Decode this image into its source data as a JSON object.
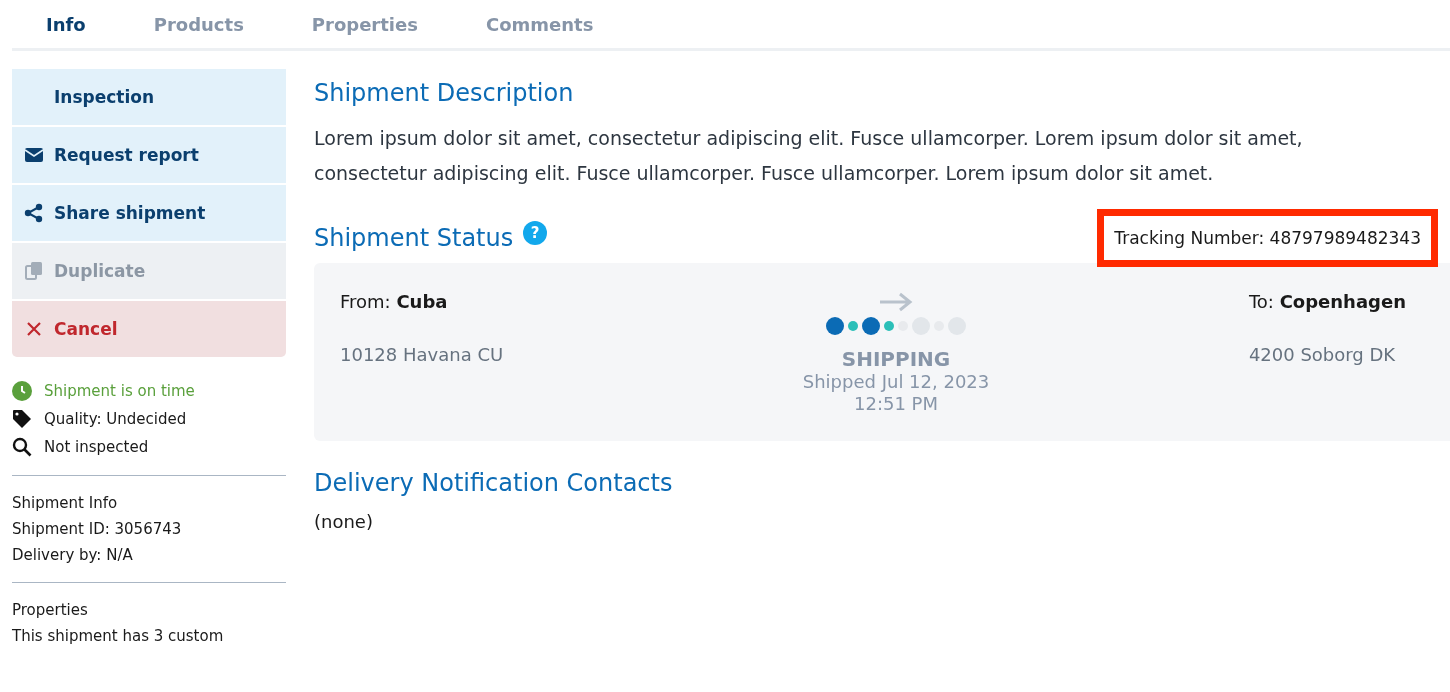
{
  "tabs": [
    {
      "label": "Info",
      "selected": true
    },
    {
      "label": "Products",
      "selected": false
    },
    {
      "label": "Properties",
      "selected": false
    },
    {
      "label": "Comments",
      "selected": false
    }
  ],
  "actions": [
    {
      "label": "Inspection",
      "kind": "plain",
      "disabled": false
    },
    {
      "label": "Request report",
      "kind": "email",
      "disabled": false
    },
    {
      "label": "Share shipment",
      "kind": "share",
      "disabled": false
    },
    {
      "label": "Duplicate",
      "kind": "duplicate",
      "disabled": true
    },
    {
      "label": "Cancel",
      "kind": "cancel",
      "disabled": false
    }
  ],
  "badges": [
    {
      "kind": "timing",
      "text": "Shipment is on time",
      "color": "#5aa03c"
    },
    {
      "kind": "quality",
      "text": "Quality: Undecided",
      "color": "#1a1a1a"
    },
    {
      "kind": "inspection",
      "text": "Not inspected",
      "color": "#1a1a1a"
    }
  ],
  "info_sections": [
    {
      "lines": [
        "Shipment Info",
        "Shipment ID: 3056743",
        "Delivery by: N/A"
      ]
    },
    {
      "lines": [
        "Properties",
        "This shipment has 3 custom"
      ]
    }
  ],
  "description": {
    "title": "Shipment Description",
    "text": "Lorem ipsum dolor sit amet, consectetur adipiscing elit. Fusce ullamcorper. Lorem ipsum dolor sit amet, consectetur adipiscing elit. Fusce ullamcorper. Fusce ullamcorper. Lorem ipsum dolor sit amet."
  },
  "status": {
    "title": "Shipment Status",
    "help": "?",
    "tracking": "Tracking Number: 48797989482343",
    "tracking_highlighted": true,
    "from_label": "From:",
    "from": "Cuba",
    "from_address": "10128 Havana CU",
    "to_label": "To:",
    "to": "Copenhagen",
    "to_address": "4200 Soborg DK",
    "progress": [
      {
        "kind": "stop",
        "done": true
      },
      {
        "kind": "leg",
        "done": true
      },
      {
        "kind": "stop",
        "done": true
      },
      {
        "kind": "leg",
        "done": true
      },
      {
        "kind": "leg",
        "done": false
      },
      {
        "kind": "stop",
        "done": false
      },
      {
        "kind": "leg",
        "done": false
      },
      {
        "kind": "stop",
        "done": false
      }
    ],
    "state": "SHIPPING",
    "shipped": "Shipped Jul 12, 2023",
    "time": "12:51 PM"
  },
  "contacts": {
    "title": "Delivery Notification Contacts",
    "text": "(none)"
  }
}
